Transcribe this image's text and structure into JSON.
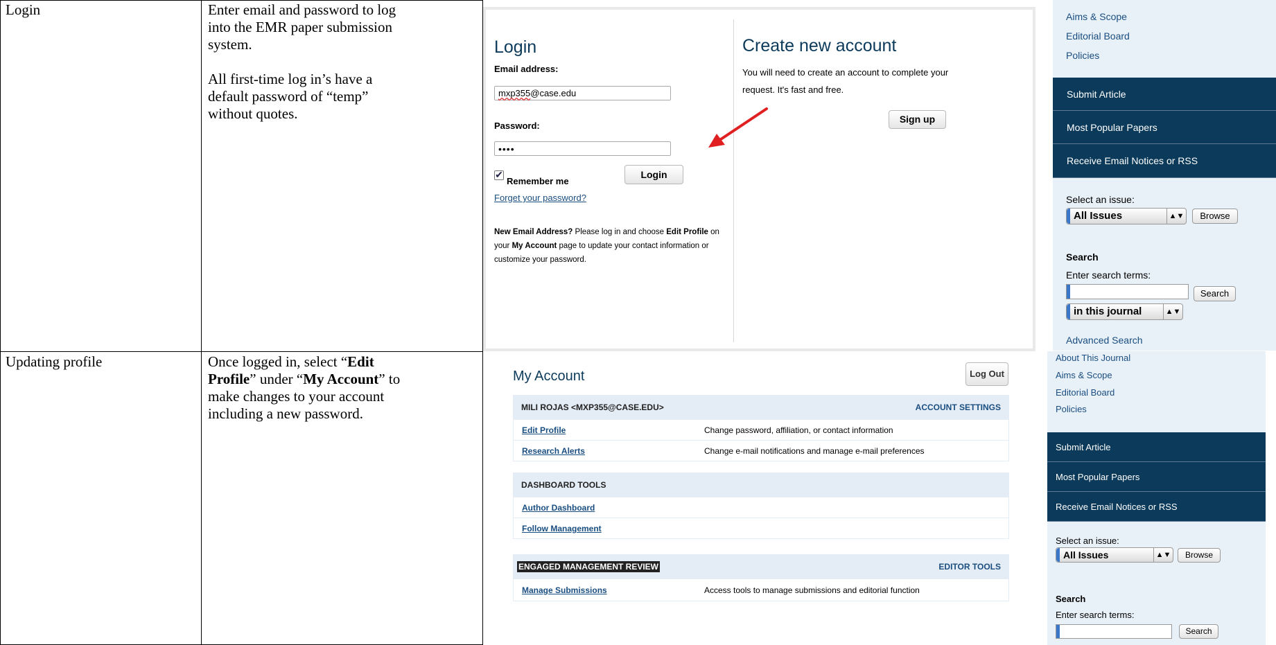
{
  "rows": [
    {
      "title": "Login",
      "description_lines": [
        "Enter email and password to log",
        "into the EMR paper submission",
        "system.",
        "",
        "All first-time log in’s have a",
        "default password of “temp”",
        "without quotes."
      ]
    },
    {
      "title": "Updating profile",
      "desc": {
        "p1": "Once logged in, select “",
        "b1": "Edit",
        "b2": "Profile",
        "p2": "” under “",
        "b3": "My Account",
        "p3": "” to",
        "l3": "make changes to your account",
        "l4": "including a new password."
      }
    }
  ],
  "login": {
    "heading": "Login",
    "email_label": "Email address:",
    "email_value_a": "mxp355",
    "email_value_b": "@case.edu",
    "password_label": "Password:",
    "password_value": "••••",
    "remember_label": "Remember me",
    "login_button": "Login",
    "forgot_link": "Forget your password?",
    "note": {
      "b1": "New Email Address?",
      "t1": " Please log in and choose ",
      "b2": "Edit Profile",
      "t2": " on",
      "t3": "your ",
      "b3": "My Account",
      "t4": " page to update your contact information or",
      "t5": "customize your password."
    }
  },
  "create": {
    "heading": "Create new account",
    "text1": "You will need to create an account to complete your",
    "text2": "request. It's fast and free.",
    "signup_button": "Sign up"
  },
  "sidebar1": {
    "links": [
      "Aims & Scope",
      "Editorial Board",
      "Policies"
    ],
    "nav": [
      "Submit Article",
      "Most Popular Papers",
      "Receive Email Notices or RSS"
    ],
    "select_label": "Select an issue:",
    "select_value": "All Issues",
    "browse_button": "Browse",
    "search_heading": "Search",
    "search_label": "Enter search terms:",
    "search_button": "Search",
    "scope_value": "in this journal",
    "advanced_link": "Advanced Search"
  },
  "account": {
    "heading": "My Account",
    "logout_button": "Log Out",
    "section1": {
      "left": "MILI ROJAS <MXP355@CASE.EDU>",
      "right": "ACCOUNT SETTINGS"
    },
    "section1_rows": [
      {
        "link": "Edit Profile",
        "desc": "Change password, affiliation, or contact information"
      },
      {
        "link": "Research Alerts",
        "desc": "Change e-mail notifications and manage e-mail preferences"
      }
    ],
    "section2": {
      "left": "DASHBOARD TOOLS"
    },
    "section2_rows": [
      {
        "link": "Author Dashboard"
      },
      {
        "link": "Follow Management"
      }
    ],
    "section3": {
      "left": "ENGAGED MANAGEMENT REVIEW",
      "right": "EDITOR TOOLS"
    },
    "section3_rows": [
      {
        "link": "Manage Submissions",
        "desc": "Access tools to manage submissions and editorial function"
      }
    ]
  },
  "sidebar2": {
    "links": [
      "About This Journal",
      "Aims & Scope",
      "Editorial Board",
      "Policies"
    ],
    "nav": [
      "Submit Article",
      "Most Popular Papers",
      "Receive Email Notices or RSS"
    ],
    "select_label": "Select an issue:",
    "select_value": "All Issues",
    "browse_button": "Browse",
    "search_heading": "Search",
    "search_label": "Enter search terms:",
    "search_button": "Search"
  },
  "colors": {
    "accent": "#0b3a5a",
    "link": "#1a4e80",
    "header_bg": "#e4ecf5",
    "arrow": "#e02020"
  }
}
